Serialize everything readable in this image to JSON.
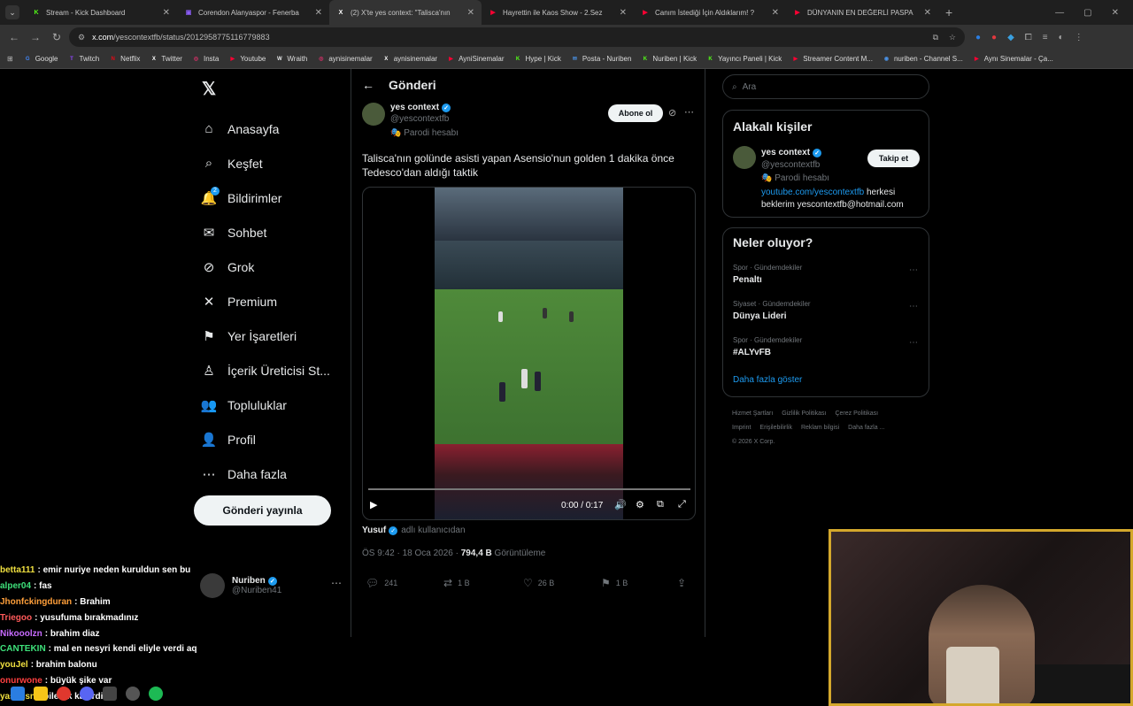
{
  "tabs": [
    {
      "title": "Stream - Kick Dashboard",
      "icon": "K",
      "color": "#53fc18",
      "active": false
    },
    {
      "title": "Corendon Alanyaspor - Fenerba",
      "icon": "▣",
      "color": "#8b5cf6",
      "active": false
    },
    {
      "title": "(2) X'te yes context: \"Talisca'nın",
      "icon": "X",
      "color": "#ffffff",
      "active": true
    },
    {
      "title": "Hayrettin ile Kaos Show - 2.Sez",
      "icon": "▶",
      "color": "#ff0033",
      "active": false
    },
    {
      "title": "Canım İstediği İçin Aldıklarım! ?",
      "icon": "▶",
      "color": "#ff0033",
      "active": false
    },
    {
      "title": "DÜNYANIN EN DEĞERLİ PASPA",
      "icon": "▶",
      "color": "#ff0033",
      "active": false
    }
  ],
  "address": {
    "domain": "x.com",
    "path": "/yescontextfb/status/2012958775116779883"
  },
  "bookmarks": [
    {
      "label": "Google",
      "icon": "G",
      "color": "#4285f4"
    },
    {
      "label": "Twitch",
      "icon": "T",
      "color": "#9146ff"
    },
    {
      "label": "Netflix",
      "icon": "N",
      "color": "#e50914"
    },
    {
      "label": "Twitter",
      "icon": "X",
      "color": "#ffffff"
    },
    {
      "label": "Insta",
      "icon": "◎",
      "color": "#e1306c"
    },
    {
      "label": "Youtube",
      "icon": "▶",
      "color": "#ff0033"
    },
    {
      "label": "Wraith",
      "icon": "W",
      "color": "#e7e9ea"
    },
    {
      "label": "aynisinemalar",
      "icon": "◎",
      "color": "#e1306c"
    },
    {
      "label": "aynisinemalar",
      "icon": "X",
      "color": "#ffffff"
    },
    {
      "label": "AyniSinemalar",
      "icon": "▶",
      "color": "#ff0033"
    },
    {
      "label": "Hype | Kick",
      "icon": "K",
      "color": "#53fc18"
    },
    {
      "label": "Posta - Nuriben",
      "icon": "✉",
      "color": "#4a90e2"
    },
    {
      "label": "Nuriben | Kick",
      "icon": "K",
      "color": "#53fc18"
    },
    {
      "label": "Yayıncı Paneli | Kick",
      "icon": "K",
      "color": "#53fc18"
    },
    {
      "label": "Streamer Content M...",
      "icon": "▶",
      "color": "#ff0033"
    },
    {
      "label": "nuriben - Channel S...",
      "icon": "◉",
      "color": "#4a90e2"
    },
    {
      "label": "Aynı Sinemalar - Ça...",
      "icon": "▶",
      "color": "#ff0033"
    }
  ],
  "x_logo": "𝕏",
  "nav": [
    {
      "label": "Anasayfa",
      "icon": "⌂",
      "name": "home"
    },
    {
      "label": "Keşfet",
      "icon": "⌕",
      "name": "explore"
    },
    {
      "label": "Bildirimler",
      "icon": "🔔",
      "name": "notifications",
      "badge": "2"
    },
    {
      "label": "Sohbet",
      "icon": "✉",
      "name": "chat"
    },
    {
      "label": "Grok",
      "icon": "⊘",
      "name": "grok"
    },
    {
      "label": "Premium",
      "icon": "✕",
      "name": "premium"
    },
    {
      "label": "Yer İşaretleri",
      "icon": "⚑",
      "name": "bookmarks"
    },
    {
      "label": "İçerik Üreticisi St...",
      "icon": "♙",
      "name": "creator-studio"
    },
    {
      "label": "Topluluklar",
      "icon": "👥",
      "name": "communities"
    },
    {
      "label": "Profil",
      "icon": "👤",
      "name": "profile"
    },
    {
      "label": "Daha fazla",
      "icon": "⋯",
      "name": "more"
    }
  ],
  "post_button": "Gönderi yayınla",
  "me": {
    "name": "Nuriben",
    "handle": "@Nuriben41"
  },
  "post": {
    "header": "Gönderi",
    "author_name": "yes context",
    "author_handle": "@yescontextfb",
    "parody": "Parodi hesabı",
    "subscribe": "Abone ol",
    "text": "Talisca'nın golünde asisti yapan Asensio'nun golden 1 dakika önce Tedesco'dan aldığı taktik",
    "video_time": "0:00 / 0:17",
    "credit_name": "Yusuf",
    "credit_source": "adlı kullanıcıdan",
    "time": "ÖS 9:42 · 18 Oca 2026 · ",
    "views": "794,4 B",
    "views_label": " Görüntüleme",
    "replies": "241",
    "reposts": "1 B",
    "likes": "26 B",
    "bookmarks": "1 B"
  },
  "search_placeholder": "Ara",
  "related": {
    "title": "Alakalı kişiler",
    "name": "yes context",
    "handle": "@yescontextfb",
    "parody": "Parodi hesabı",
    "follow": "Takip et",
    "bio_link": "youtube.com/yescontextfb",
    "bio_rest": " herkesi beklerim yescontextfb@hotmail.com"
  },
  "trends": {
    "title": "Neler oluyor?",
    "items": [
      {
        "category": "Spor · Gündemdekiler",
        "name": "Penaltı"
      },
      {
        "category": "Siyaset · Gündemdekiler",
        "name": "Dünya Lideri"
      },
      {
        "category": "Spor · Gündemdekiler",
        "name": "#ALYvFB"
      }
    ],
    "show_more": "Daha fazla göster"
  },
  "footer": [
    "Hizmet Şartları",
    "Gizlilik Politikası",
    "Çerez Politikası",
    "Imprint",
    "Erişilebilirlik",
    "Reklam bilgisi",
    "Daha fazla ...",
    "© 2026 X Corp."
  ],
  "chat": [
    {
      "user": "betta111",
      "color": "#f0e040",
      "msg": "emir nuriye neden kuruldun sen bu"
    },
    {
      "user": "alper04",
      "color": "#3ee07a",
      "msg": "fas"
    },
    {
      "user": "Jhonfckingduran",
      "color": "#ff9f3a",
      "msg": "Brahim"
    },
    {
      "user": "Triegoo",
      "color": "#ff5a5a",
      "msg": "yusufuma bırakmadınız"
    },
    {
      "user": "Nikooolzn",
      "color": "#c86bff",
      "msg": "brahim diaz"
    },
    {
      "user": "CANTEKIN",
      "color": "#3ee07a",
      "msg": "mal en nesyri kendi eliyle verdi aq"
    },
    {
      "user": "youJel",
      "color": "#f0e040",
      "msg": "brahim balonu"
    },
    {
      "user": "onurwone",
      "color": "#ff4040",
      "msg": "büyük şike var"
    },
    {
      "user": "yasinjsn",
      "color": "#f0e040",
      "msg": "bilerek kacirdi"
    }
  ]
}
